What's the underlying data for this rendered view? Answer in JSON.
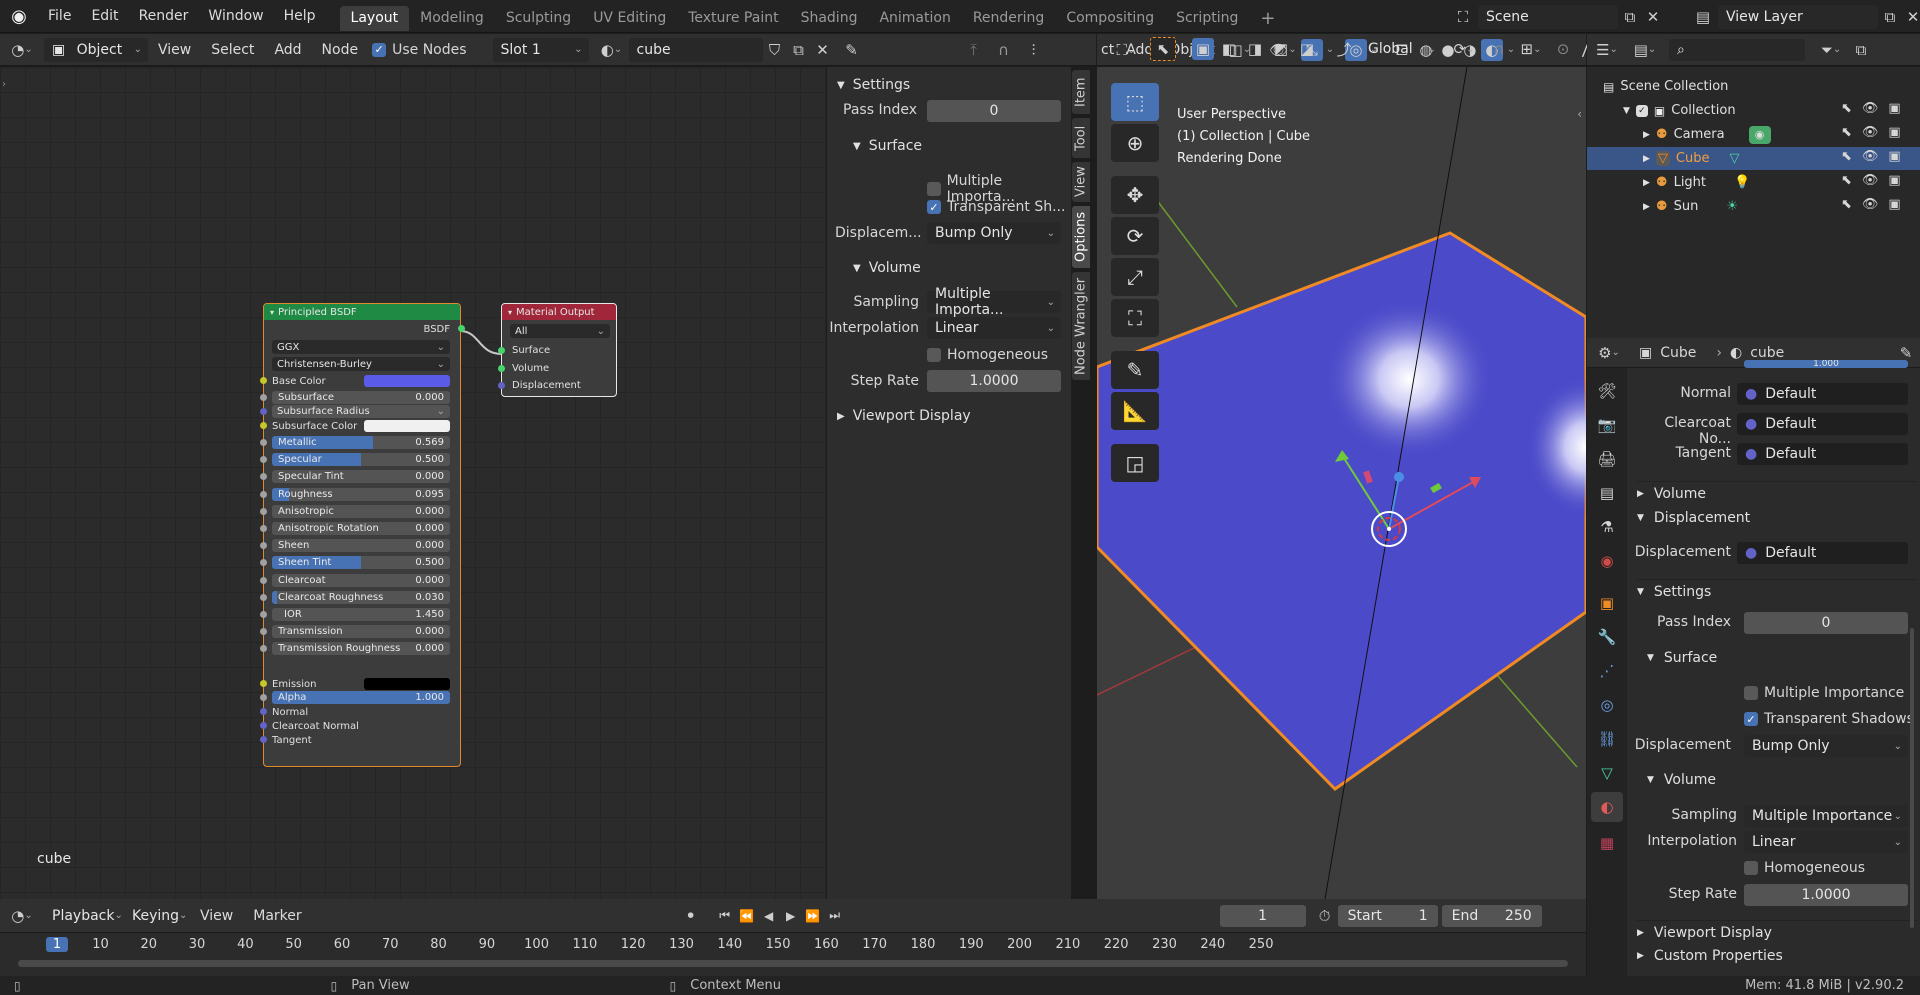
{
  "topbar": {
    "menus": [
      "File",
      "Edit",
      "Render",
      "Window",
      "Help"
    ],
    "workspaces": [
      "Layout",
      "Modeling",
      "Sculpting",
      "UV Editing",
      "Texture Paint",
      "Shading",
      "Animation",
      "Rendering",
      "Compositing",
      "Scripting"
    ],
    "active_workspace": "Layout",
    "add_workspace": "+",
    "scene": "Scene",
    "view_layer": "View Layer"
  },
  "node_header": {
    "object_mode": "Object",
    "menus": [
      "View",
      "Select",
      "Add",
      "Node"
    ],
    "use_nodes_label": "Use Nodes",
    "slot": "Slot 1",
    "material": "cube"
  },
  "node_editor": {
    "material_label": "cube",
    "bsdf": {
      "title": "Principled BSDF",
      "output": "BSDF",
      "distribution": "GGX",
      "subsurface_method": "Christensen-Burley",
      "base_color_label": "Base Color",
      "base_color": "#5a5be6",
      "subsurface_label": "Subsurface",
      "subsurface_value": "0.000",
      "subsurface_radius_label": "Subsurface Radius",
      "subsurface_color_label": "Subsurface Color",
      "sliders": [
        {
          "label": "Metallic",
          "value": "0.569",
          "fraction": 0.569
        },
        {
          "label": "Specular",
          "value": "0.500",
          "fraction": 0.5
        },
        {
          "label": "Specular Tint",
          "value": "0.000",
          "fraction": 0
        },
        {
          "label": "Roughness",
          "value": "0.095",
          "fraction": 0.095
        },
        {
          "label": "Anisotropic",
          "value": "0.000",
          "fraction": 0
        },
        {
          "label": "Anisotropic Rotation",
          "value": "0.000",
          "fraction": 0
        },
        {
          "label": "Sheen",
          "value": "0.000",
          "fraction": 0
        },
        {
          "label": "Sheen Tint",
          "value": "0.500",
          "fraction": 0.5
        },
        {
          "label": "Clearcoat",
          "value": "0.000",
          "fraction": 0
        },
        {
          "label": "Clearcoat Roughness",
          "value": "0.030",
          "fraction": 0.03
        },
        {
          "label": "IOR",
          "value": "1.450",
          "fraction": 0
        },
        {
          "label": "Transmission",
          "value": "0.000",
          "fraction": 0
        },
        {
          "label": "Transmission Roughness",
          "value": "0.000",
          "fraction": 0
        }
      ],
      "emission_label": "Emission",
      "alpha_label": "Alpha",
      "alpha_value": "1.000",
      "normal_label": "Normal",
      "clearcoat_normal_label": "Clearcoat Normal",
      "tangent_label": "Tangent"
    },
    "output": {
      "title": "Material Output",
      "target": "All",
      "inputs": [
        "Surface",
        "Volume",
        "Displacement"
      ]
    }
  },
  "n_panel": {
    "settings": "Settings",
    "pass_index_label": "Pass Index",
    "pass_index": "0",
    "surface": "Surface",
    "multiple_importance": "Multiple Importa...",
    "transparent_shadows": "Transparent Sh...",
    "displacement_label": "Displacem...",
    "displacement_value": "Bump Only",
    "volume": "Volume",
    "sampling_label": "Sampling",
    "sampling_value": "Multiple Importa...",
    "interpolation_label": "Interpolation",
    "interpolation_value": "Linear",
    "homogeneous": "Homogeneous",
    "step_rate_label": "Step Rate",
    "step_rate": "1.0000",
    "viewport_display": "Viewport Display",
    "tabs": [
      "Item",
      "Tool",
      "View",
      "Options",
      "Node Wrangler"
    ]
  },
  "viewport": {
    "header_menus": [
      "ct",
      "Add",
      "Object"
    ],
    "orientation": "Global",
    "info": [
      "User Perspective",
      "(1) Collection | Cube",
      "Rendering Done"
    ]
  },
  "outliner": {
    "scene_collection": "Scene Collection",
    "items": [
      {
        "name": "Collection"
      },
      {
        "name": "Camera"
      },
      {
        "name": "Cube"
      },
      {
        "name": "Light"
      },
      {
        "name": "Sun"
      }
    ]
  },
  "properties": {
    "object": "Cube",
    "material": "cube",
    "alpha_value": "1.000",
    "normal_label": "Normal",
    "normal_value": "Default",
    "clearcoat_normal_label": "Clearcoat No...",
    "clearcoat_normal_value": "Default",
    "tangent_label": "Tangent",
    "tangent_value": "Default",
    "volume": "Volume",
    "displacement_section": "Displacement",
    "displacement_label": "Displacement",
    "displacement_value": "Default",
    "settings": "Settings",
    "pass_index_label": "Pass Index",
    "pass_index": "0",
    "surface": "Surface",
    "multiple_importance": "Multiple Importance",
    "transparent_shadows": "Transparent Shadows",
    "surf_displacement_label": "Displacement",
    "surf_displacement_value": "Bump Only",
    "volume_sub": "Volume",
    "sampling_label": "Sampling",
    "sampling_value": "Multiple Importance",
    "interpolation_label": "Interpolation",
    "interpolation_value": "Linear",
    "homogeneous": "Homogeneous",
    "step_rate_label": "Step Rate",
    "step_rate": "1.0000",
    "viewport_display": "Viewport Display",
    "custom_properties": "Custom Properties"
  },
  "timeline": {
    "menus": [
      "Playback",
      "Keying",
      "View",
      "Marker"
    ],
    "current_frame": "1",
    "start_label": "Start",
    "start": "1",
    "end_label": "End",
    "end": "250",
    "ruler": [
      "1",
      "10",
      "20",
      "30",
      "40",
      "50",
      "60",
      "70",
      "80",
      "90",
      "100",
      "110",
      "120",
      "130",
      "140",
      "150",
      "160",
      "170",
      "180",
      "190",
      "200",
      "210",
      "220",
      "230",
      "240",
      "250"
    ]
  },
  "statusbar": {
    "pan": "Pan View",
    "context": "Context Menu",
    "memory": "Mem: 41.8 MiB | v2.90.2"
  },
  "colors": {
    "accent": "#4772b3",
    "selection": "#f08a24",
    "cube": "#4b4ac9"
  }
}
